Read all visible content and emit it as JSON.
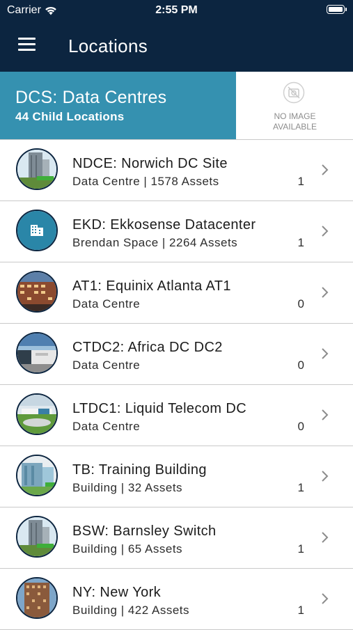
{
  "status": {
    "carrier": "Carrier",
    "time": "2:55 PM"
  },
  "nav": {
    "title": "Locations",
    "menu_icon": "hamburger-menu-icon"
  },
  "header": {
    "title": "DCS: Data Centres",
    "subtitle": "44 Child Locations",
    "no_image_line1": "NO IMAGE",
    "no_image_line2": "AVAILABLE",
    "accent_color": "#3591b0"
  },
  "colors": {
    "navbar": "#0c2540",
    "accent": "#3591b0",
    "list_bg": "#ffffff"
  },
  "locations": [
    {
      "title": "NDCE: Norwich DC Site",
      "subtitle": "Data Centre | 1578 Assets",
      "count": "1",
      "thumb": "tower-photo"
    },
    {
      "title": "EKD: Ekkosense Datacenter",
      "subtitle": "Brendan Space | 2264 Assets",
      "count": "1",
      "thumb": "building-icon"
    },
    {
      "title": "AT1: Equinix Atlanta AT1",
      "subtitle": "Data Centre",
      "count": "0",
      "thumb": "brick-building-photo"
    },
    {
      "title": "CTDC2: Africa DC DC2",
      "subtitle": "Data Centre",
      "count": "0",
      "thumb": "warehouse-photo"
    },
    {
      "title": "LTDC1: Liquid Telecom DC",
      "subtitle": "Data Centre",
      "count": "0",
      "thumb": "campus-photo"
    },
    {
      "title": "TB: Training Building",
      "subtitle": "Building | 32 Assets",
      "count": "1",
      "thumb": "glass-building-photo"
    },
    {
      "title": "BSW: Barnsley Switch",
      "subtitle": "Building | 65 Assets",
      "count": "1",
      "thumb": "tower-photo"
    },
    {
      "title": "NY: New York",
      "subtitle": "Building | 422 Assets",
      "count": "1",
      "thumb": "brick-tower-photo"
    }
  ]
}
